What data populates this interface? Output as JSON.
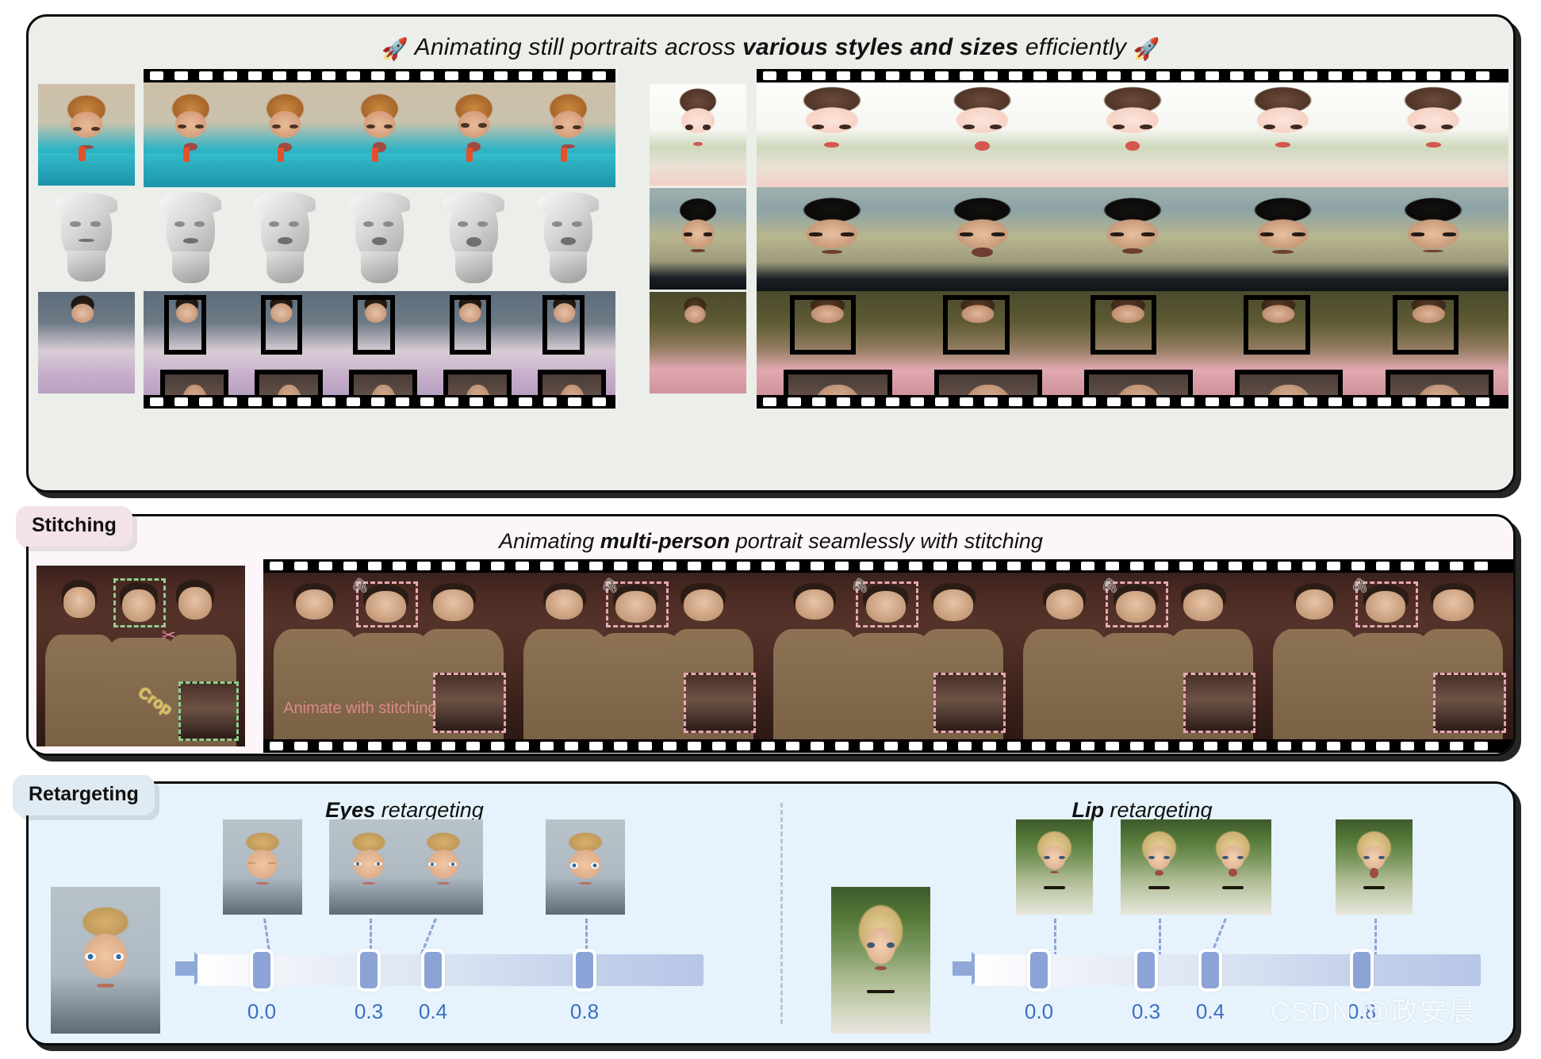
{
  "page": {
    "watermark": "CSDN @政安晨"
  },
  "styles_panel": {
    "title_prefix": "Animating still portraits across ",
    "title_bold": "various styles and sizes",
    "title_suffix": " efficiently",
    "rocket_icon": "🚀",
    "background_color": "#ebeee9",
    "rows": [
      {
        "id": "row-painted-girl",
        "source_label": "painted girl portrait",
        "frames": 5
      },
      {
        "id": "row-statue",
        "source_label": "marble statue bust",
        "frames": 5
      },
      {
        "id": "row-victorian",
        "source_label": "victorian sofa painting",
        "frames": 5
      }
    ],
    "rows_right": [
      {
        "id": "row-anime",
        "source_label": "anime illustration portrait",
        "frames": 5
      },
      {
        "id": "row-man",
        "source_label": "asian man photo",
        "frames": 5
      },
      {
        "id": "row-lady",
        "source_label": "victorian lady painting",
        "frames": 5
      }
    ]
  },
  "stitching_panel": {
    "tag": "Stitching",
    "tag_color": "#f3e3e9",
    "title_prefix": "Animating ",
    "title_bold": "multi-person",
    "title_suffix": " portrait seamlessly with stitching",
    "background_color": "#fcf6fa",
    "crop_label": "Crop",
    "animate_label": "Animate with stitching",
    "scissors_icon": "✂",
    "paperclip_icon": "🖇",
    "frames": 5
  },
  "retargeting_panel": {
    "tag": "Retargeting",
    "tag_color": "#dfeaf2",
    "background_color": "#e6f3fc",
    "background_accent": "#8ba3d6",
    "label_color": "#3d6fc0",
    "left": {
      "title_bold": "Eyes",
      "title_rest": " retargeting",
      "source_label": "3d boy render",
      "values": [
        "0.0",
        "0.3",
        "0.4",
        "0.8"
      ],
      "knob_positions_pct": [
        9.0,
        38.5,
        51.5,
        90.0
      ]
    },
    "right": {
      "title_bold": "Lip",
      "title_rest": " retargeting",
      "source_label": "blonde woman photo",
      "values": [
        "0.0",
        "0.3",
        "0.4",
        "0.8"
      ],
      "knob_positions_pct": [
        9.0,
        38.5,
        51.5,
        90.0
      ]
    }
  }
}
